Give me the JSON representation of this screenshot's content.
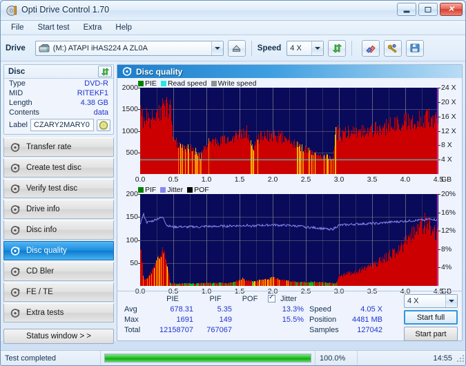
{
  "window": {
    "title": "Opti Drive Control 1.70",
    "icon": "disc-icon",
    "buttons": {
      "minimize": "minimize-icon",
      "maximize": "maximize-icon",
      "close": "✕"
    }
  },
  "menu": {
    "items": [
      "File",
      "Start test",
      "Extra",
      "Help"
    ]
  },
  "toolbar": {
    "drive_label": "Drive",
    "drive_value": "(M:)   ATAPI iHAS224   A ZL0A",
    "eject_icon": "eject-icon",
    "speed_label": "Speed",
    "speed_value": "4 X",
    "refresh_icon": "refresh-icon",
    "eraser_icon": "eraser-icon",
    "tools_icon": "tools-icon",
    "save_icon": "save-icon"
  },
  "disc_panel": {
    "title": "Disc",
    "refresh_icon": "refresh-icon",
    "rows": [
      {
        "key": "Type",
        "value": "DVD-R"
      },
      {
        "key": "MID",
        "value": "RITEKF1"
      },
      {
        "key": "Length",
        "value": "4.38 GB"
      },
      {
        "key": "Contents",
        "value": "data"
      }
    ],
    "label_key": "Label",
    "label_value": "CZARY2MARY0",
    "label_icon": "disc-icon"
  },
  "sidebar": {
    "items": [
      {
        "label": "Transfer rate",
        "icon": "disc-icon",
        "active": false
      },
      {
        "label": "Create test disc",
        "icon": "disc-icon",
        "active": false
      },
      {
        "label": "Verify test disc",
        "icon": "disc-icon",
        "active": false
      },
      {
        "label": "Drive info",
        "icon": "disc-icon",
        "active": false
      },
      {
        "label": "Disc info",
        "icon": "disc-icon",
        "active": false
      },
      {
        "label": "Disc quality",
        "icon": "disc-icon",
        "active": true
      },
      {
        "label": "CD Bler",
        "icon": "disc-icon",
        "active": false
      },
      {
        "label": "FE / TE",
        "icon": "disc-icon",
        "active": false
      },
      {
        "label": "Extra tests",
        "icon": "disc-icon",
        "active": false
      }
    ],
    "status_window_button": "Status window > >"
  },
  "pane": {
    "title": "Disc quality",
    "icon": "disc-icon"
  },
  "stats": {
    "columns": [
      "PIE",
      "PIF",
      "POF",
      "Jitter"
    ],
    "jitter_checked": true,
    "rows": [
      {
        "label": "Avg",
        "pie": "678.31",
        "pif": "5.35",
        "pof": "",
        "jitter": "13.3%"
      },
      {
        "label": "Max",
        "pie": "1691",
        "pif": "149",
        "pof": "",
        "jitter": "15.5%"
      },
      {
        "label": "Total",
        "pie": "12158707",
        "pif": "767067",
        "pof": "",
        "jitter": ""
      }
    ],
    "info": [
      {
        "key": "Speed",
        "value": "4.05 X"
      },
      {
        "key": "Position",
        "value": "4481 MB"
      },
      {
        "key": "Samples",
        "value": "127042"
      }
    ],
    "speed_select": "4 X",
    "start_full": "Start full",
    "start_part": "Start part"
  },
  "statusbar": {
    "message": "Test completed",
    "percent_label": "100.0%",
    "percent_value": 100,
    "time": "14:55"
  },
  "colors": {
    "pie": "#cc0000",
    "pif": "#00c000",
    "pof": "#000000",
    "jitter": "#8888ee",
    "read_speed": "#25e8e8",
    "write_speed": "#909090",
    "plot_bg": "#0a0a5a",
    "accent": "#2034cf"
  },
  "chart_data": [
    {
      "type": "area",
      "title": "PIE / Read speed",
      "legend": [
        {
          "label": "PIE",
          "color": "#008000"
        },
        {
          "label": "Read speed",
          "color": "#25e8e8"
        },
        {
          "label": "Write speed",
          "color": "#909090"
        }
      ],
      "legend_position": "top-left",
      "xlabel": "GB",
      "x_ticks": [
        "0.0",
        "0.5",
        "1.0",
        "1.5",
        "2.0",
        "2.5",
        "3.0",
        "3.5",
        "4.0",
        "4.5"
      ],
      "xlim": [
        0,
        4.5
      ],
      "ylabel_left": "PIE",
      "y_ticks_left": [
        "500",
        "1000",
        "1500",
        "2000"
      ],
      "ylim_left": [
        0,
        2000
      ],
      "ylabel_right": "Speed",
      "y_ticks_right": [
        "4 X",
        "8 X",
        "12 X",
        "16 X",
        "20 X",
        "24 X"
      ],
      "ylim_right": [
        0,
        24
      ],
      "grid": true,
      "read_speed_constant": 4.05,
      "series": [
        {
          "name": "PIE",
          "color": "#cc0000",
          "x": [
            0.0,
            0.05,
            0.1,
            0.15,
            0.2,
            0.25,
            0.3,
            0.35,
            0.4,
            0.45,
            0.5,
            0.55,
            0.6,
            0.65,
            0.7,
            0.75,
            0.8,
            0.85,
            0.9,
            0.95,
            1.0,
            1.05,
            1.1,
            1.15,
            1.2,
            1.25,
            1.3,
            1.35,
            1.4,
            1.45,
            1.5,
            1.55,
            1.6,
            1.65,
            1.7,
            1.75,
            1.8,
            1.85,
            1.9,
            1.95,
            2.0,
            2.05,
            2.1,
            2.15,
            2.2,
            2.25,
            2.3,
            2.35,
            2.4,
            2.45,
            2.5,
            2.55,
            2.6,
            2.65,
            2.7,
            2.75,
            2.8,
            2.85,
            2.9,
            2.95,
            3.0,
            3.05,
            3.1,
            3.15,
            3.2,
            3.25,
            3.3,
            3.35,
            3.4,
            3.45,
            3.5,
            3.55,
            3.6,
            3.65,
            3.7,
            3.75,
            3.8,
            3.85,
            3.9,
            3.95,
            4.0,
            4.05,
            4.1,
            4.15,
            4.2,
            4.25,
            4.3,
            4.35,
            4.4,
            4.45
          ],
          "values": [
            1680,
            1250,
            1350,
            1200,
            1420,
            1380,
            1500,
            1540,
            1580,
            1560,
            880,
            760,
            700,
            660,
            620,
            600,
            560,
            520,
            420,
            560,
            700,
            720,
            760,
            780,
            800,
            820,
            800,
            840,
            860,
            880,
            900,
            940,
            1000,
            900,
            560,
            820,
            880,
            900,
            920,
            900,
            880,
            900,
            880,
            860,
            840,
            800,
            760,
            700,
            640,
            600,
            560,
            520,
            480,
            460,
            430,
            420,
            400,
            380,
            360,
            980,
            960,
            940,
            960,
            980,
            960,
            980,
            1000,
            1020,
            1000,
            1040,
            1060,
            1080,
            1100,
            1120,
            1100,
            1140,
            1160,
            1180,
            1200,
            1220,
            1240,
            1220,
            1260,
            1280,
            1260,
            1290,
            1300,
            1320,
            1300,
            1280,
            1340
          ]
        }
      ]
    },
    {
      "type": "area",
      "title": "PIF / Jitter / POF",
      "legend": [
        {
          "label": "PIF",
          "color": "#008000"
        },
        {
          "label": "Jitter",
          "color": "#8888ee"
        },
        {
          "label": "POF",
          "color": "#000000"
        }
      ],
      "legend_position": "top-left",
      "xlabel": "GB",
      "x_ticks": [
        "0.0",
        "0.5",
        "1.0",
        "1.5",
        "2.0",
        "2.5",
        "3.0",
        "3.5",
        "4.0",
        "4.5"
      ],
      "xlim": [
        0,
        4.5
      ],
      "ylabel_left": "PIF",
      "y_ticks_left": [
        "50",
        "100",
        "150",
        "200"
      ],
      "ylim_left": [
        0,
        200
      ],
      "ylabel_right": "Jitter",
      "y_ticks_right": [
        "4%",
        "8%",
        "12%",
        "16%",
        "20%"
      ],
      "ylim_right": [
        0,
        20
      ],
      "grid": true,
      "series": [
        {
          "name": "PIF",
          "color": "#cc0000",
          "x": [
            0.0,
            0.05,
            0.1,
            0.15,
            0.2,
            0.25,
            0.3,
            0.35,
            0.4,
            0.45,
            0.5,
            0.6,
            0.7,
            0.8,
            0.9,
            1.0,
            1.1,
            1.2,
            1.3,
            1.4,
            1.5,
            1.55,
            1.6,
            1.7,
            1.8,
            1.9,
            2.0,
            2.05,
            2.1,
            2.2,
            2.3,
            2.4,
            2.5,
            2.6,
            2.7,
            2.8,
            2.9,
            2.95,
            3.0,
            3.1,
            3.2,
            3.3,
            3.4,
            3.5,
            3.6,
            3.7,
            3.8,
            3.9,
            4.0,
            4.1,
            4.2,
            4.3,
            4.35,
            4.4
          ],
          "values": [
            98,
            14,
            18,
            28,
            40,
            52,
            70,
            75,
            48,
            6,
            5,
            5,
            6,
            5,
            6,
            7,
            6,
            7,
            6,
            8,
            14,
            16,
            12,
            10,
            12,
            14,
            18,
            16,
            14,
            12,
            10,
            9,
            8,
            9,
            8,
            8,
            6,
            5,
            22,
            26,
            30,
            34,
            40,
            46,
            54,
            62,
            72,
            84,
            96,
            112,
            128,
            140,
            146,
            120
          ]
        },
        {
          "name": "Jitter",
          "color": "#8888ee",
          "x": [
            0.0,
            0.05,
            0.1,
            0.15,
            0.2,
            0.25,
            0.3,
            0.35,
            0.4,
            0.5,
            0.6,
            0.7,
            0.8,
            0.9,
            1.0,
            1.1,
            1.2,
            1.3,
            1.4,
            1.5,
            1.6,
            1.7,
            1.8,
            1.9,
            2.0,
            2.1,
            2.2,
            2.3,
            2.4,
            2.5,
            2.6,
            2.7,
            2.8,
            2.9,
            3.0,
            3.1,
            3.2,
            3.3,
            3.4,
            3.5,
            3.6,
            3.7,
            3.8,
            3.9,
            4.0,
            4.1,
            4.2,
            4.3,
            4.4,
            4.45
          ],
          "values": [
            13.5,
            15.6,
            13.8,
            14.0,
            14.2,
            14.6,
            14.8,
            14.9,
            13.2,
            12.8,
            12.9,
            12.8,
            12.9,
            12.8,
            13.0,
            12.9,
            13.0,
            13.0,
            13.1,
            13.1,
            13.2,
            13.0,
            13.2,
            13.2,
            13.3,
            13.2,
            13.2,
            13.1,
            13.0,
            12.8,
            12.7,
            12.6,
            12.4,
            12.3,
            13.2,
            13.3,
            13.4,
            13.5,
            13.5,
            13.6,
            13.6,
            13.8,
            13.9,
            14.0,
            14.1,
            14.2,
            14.3,
            14.4,
            14.6,
            14.4
          ]
        }
      ]
    }
  ]
}
